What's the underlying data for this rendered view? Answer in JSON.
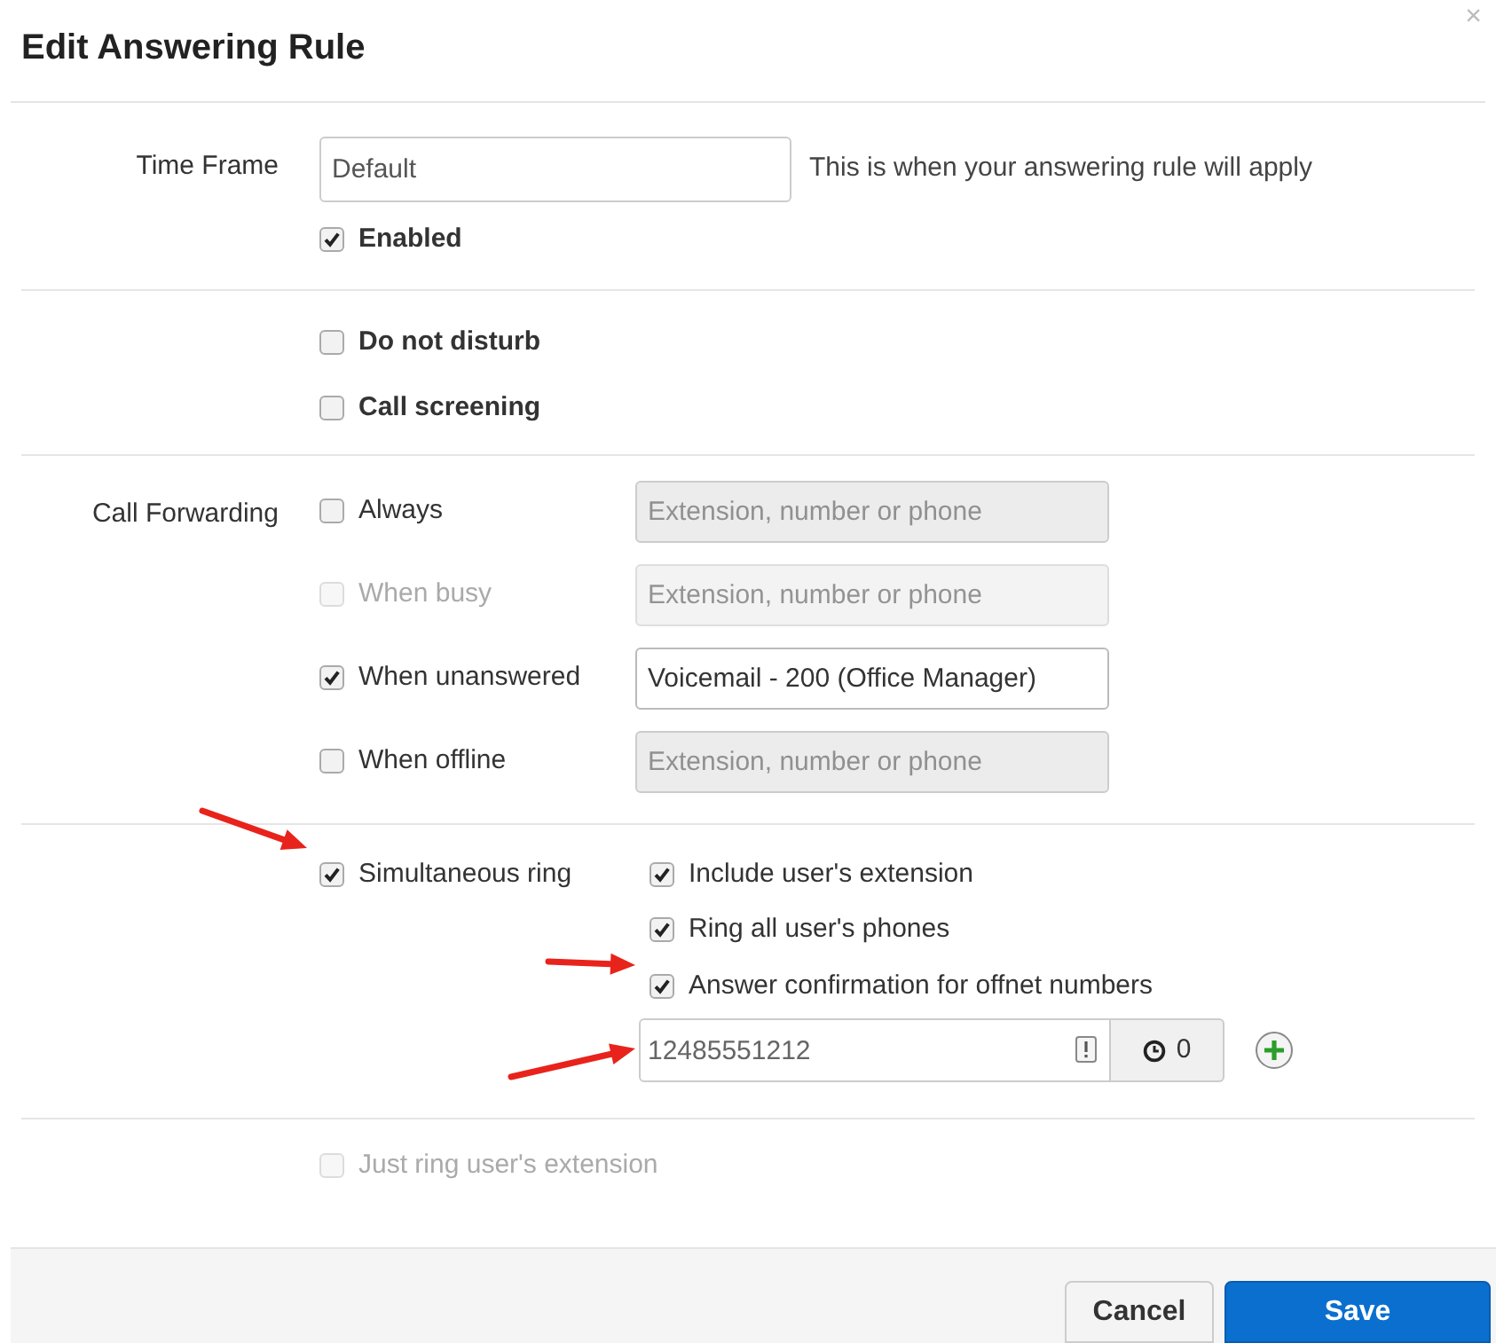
{
  "dialog": {
    "title": "Edit Answering Rule",
    "close": "×"
  },
  "time_frame": {
    "label": "Time Frame",
    "value": "Default",
    "hint": "This is when your answering rule will apply",
    "enabled": {
      "label": "Enabled",
      "checked": true
    }
  },
  "options": [
    {
      "label": "Do not disturb",
      "checked": false
    },
    {
      "label": "Call screening",
      "checked": false
    }
  ],
  "call_forwarding": {
    "label": "Call Forwarding",
    "rows": [
      {
        "label": "Always",
        "checked": false,
        "disabled": false,
        "placeholder": "Extension, number or phone"
      },
      {
        "label": "When busy",
        "checked": false,
        "disabled": true,
        "placeholder": "Extension, number or phone"
      },
      {
        "label": "When unanswered",
        "checked": true,
        "disabled": false,
        "value": "Voicemail - 200 (Office Manager)"
      },
      {
        "label": "When offline",
        "checked": false,
        "disabled": false,
        "placeholder": "Extension, number or phone"
      }
    ]
  },
  "simultaneous_ring": {
    "label": "Simultaneous ring",
    "checked": true,
    "options": [
      {
        "label": "Include user's extension",
        "checked": true
      },
      {
        "label": "Ring all user's phones",
        "checked": true
      },
      {
        "label": "Answer confirmation for offnet numbers",
        "checked": true
      }
    ],
    "number": {
      "value": "12485551212",
      "delay": "0"
    }
  },
  "just_ring": {
    "label": "Just ring user's extension",
    "checked": false,
    "disabled": true
  },
  "buttons": [
    {
      "label": "Cancel",
      "kind": "secondary"
    },
    {
      "label": "Save",
      "kind": "primary"
    }
  ]
}
